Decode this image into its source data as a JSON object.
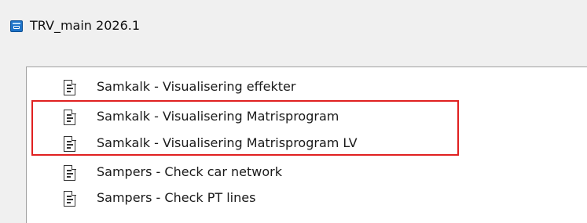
{
  "window": {
    "title": "TRV_main 2026.1",
    "icon": "app-window-icon"
  },
  "tree": {
    "items": [
      {
        "label": "Samkalk - Visualisering effekter",
        "icon": "document-icon"
      },
      {
        "label": "Samkalk - Visualisering Matrisprogram",
        "icon": "document-icon"
      },
      {
        "label": "Samkalk - Visualisering Matrisprogram LV",
        "icon": "document-icon"
      },
      {
        "label": "Sampers - Check car network",
        "icon": "document-icon"
      },
      {
        "label": "Sampers - Check PT lines",
        "icon": "document-icon"
      }
    ]
  },
  "annotation": {
    "highlight_color": "#e02020"
  }
}
